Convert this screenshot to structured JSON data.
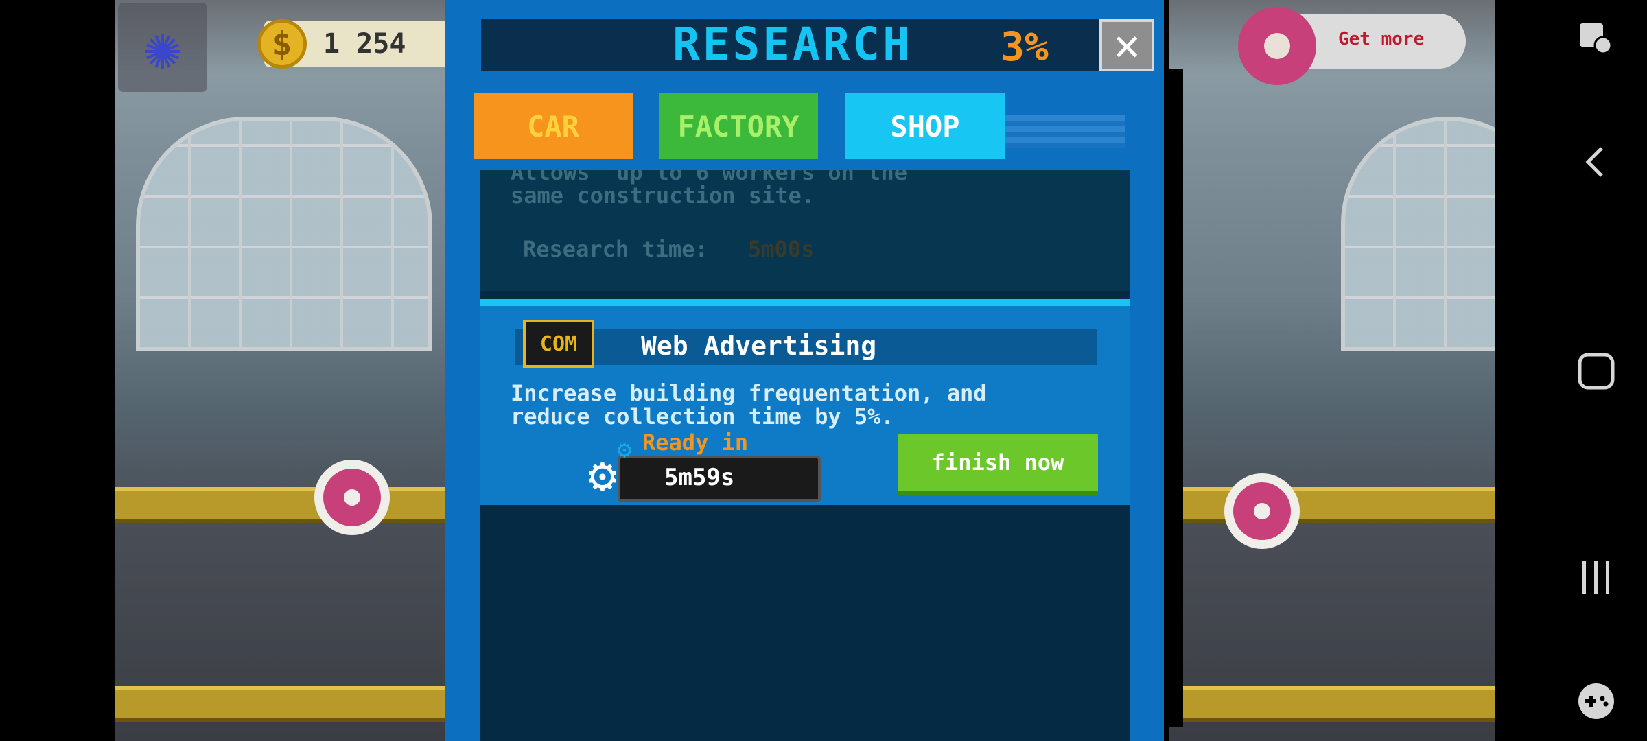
{
  "hud": {
    "coins": "1 254",
    "coin_symbol": "$",
    "get_more_label": "Get more"
  },
  "research": {
    "title": "RESEARCH",
    "progress_percent": "3%",
    "close_symbol": "✕",
    "tabs": [
      {
        "label": "CAR",
        "color": "#f7941d"
      },
      {
        "label": "FACTORY",
        "color": "#3cb83a"
      },
      {
        "label": "SHOP",
        "color": "#17c6f3"
      }
    ],
    "active_tab": "SHOP",
    "faded_card": {
      "description": "Allows  up to 6 workers on the\nsame construction site.",
      "time_label": "Research time:",
      "time_value": "5m00s"
    },
    "active_card": {
      "icon_text": "COM",
      "title": "Web Advertising",
      "description": "Increase building frequentation, and\nreduce collection time by 5%.",
      "ready_label": "Ready in",
      "timer": "5m59s",
      "finish_button": "finish now"
    }
  },
  "colors": {
    "accent_cyan": "#16c4f4",
    "accent_orange": "#f7941d",
    "finish_green": "#6cc72a",
    "modal_blue": "#0d6fc0"
  },
  "nav_icons": [
    "screen-capture-icon",
    "back-icon",
    "home-icon",
    "recents-icon",
    "game-tools-icon"
  ]
}
